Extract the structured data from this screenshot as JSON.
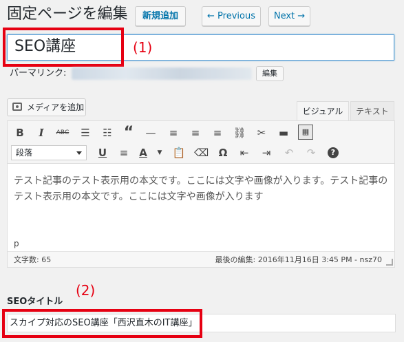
{
  "page": {
    "title": "固定ページを編集",
    "new_button": "新規追加",
    "prev_button": "← Previous",
    "next_button": "Next →"
  },
  "post_title": "SEO講座",
  "annotations": {
    "label1": "(1)",
    "label2": "(2)",
    "color": "#e60012"
  },
  "permalink": {
    "label": "パーマリンク:",
    "edit_button": "編集"
  },
  "media_button": "メディアを追加",
  "tabs": {
    "visual": "ビジュアル",
    "text": "テキスト"
  },
  "toolbar": {
    "row1_icons": [
      "bold-icon",
      "italic-icon",
      "strikethrough-icon",
      "bullet-list-icon",
      "numbered-list-icon",
      "blockquote-icon",
      "horizontal-line-icon",
      "align-left-icon",
      "align-center-icon",
      "align-right-icon",
      "link-icon",
      "unlink-icon",
      "read-more-icon",
      "toolbar-toggle-icon"
    ],
    "format_select": "段落",
    "row2_icons": [
      "underline-icon",
      "justify-icon",
      "text-color-icon",
      "paste-text-icon",
      "clear-format-icon",
      "special-char-icon",
      "outdent-icon",
      "indent-icon",
      "undo-icon",
      "redo-icon",
      "help-icon"
    ]
  },
  "content": "テスト記事のテスト表示用の本文です。ここには文字や画像が入ります。テスト記事のテスト表示用の本文です。ここには文字や画像が入ります",
  "path": "p",
  "status": {
    "word_count": "文字数: 65",
    "last_edit": "最後の編集: 2016年11月16日 3:45 PM - nsz70"
  },
  "seo": {
    "label": "SEOタイトル",
    "value": "スカイプ対応のSEO講座「西沢直木のIT講座」"
  }
}
